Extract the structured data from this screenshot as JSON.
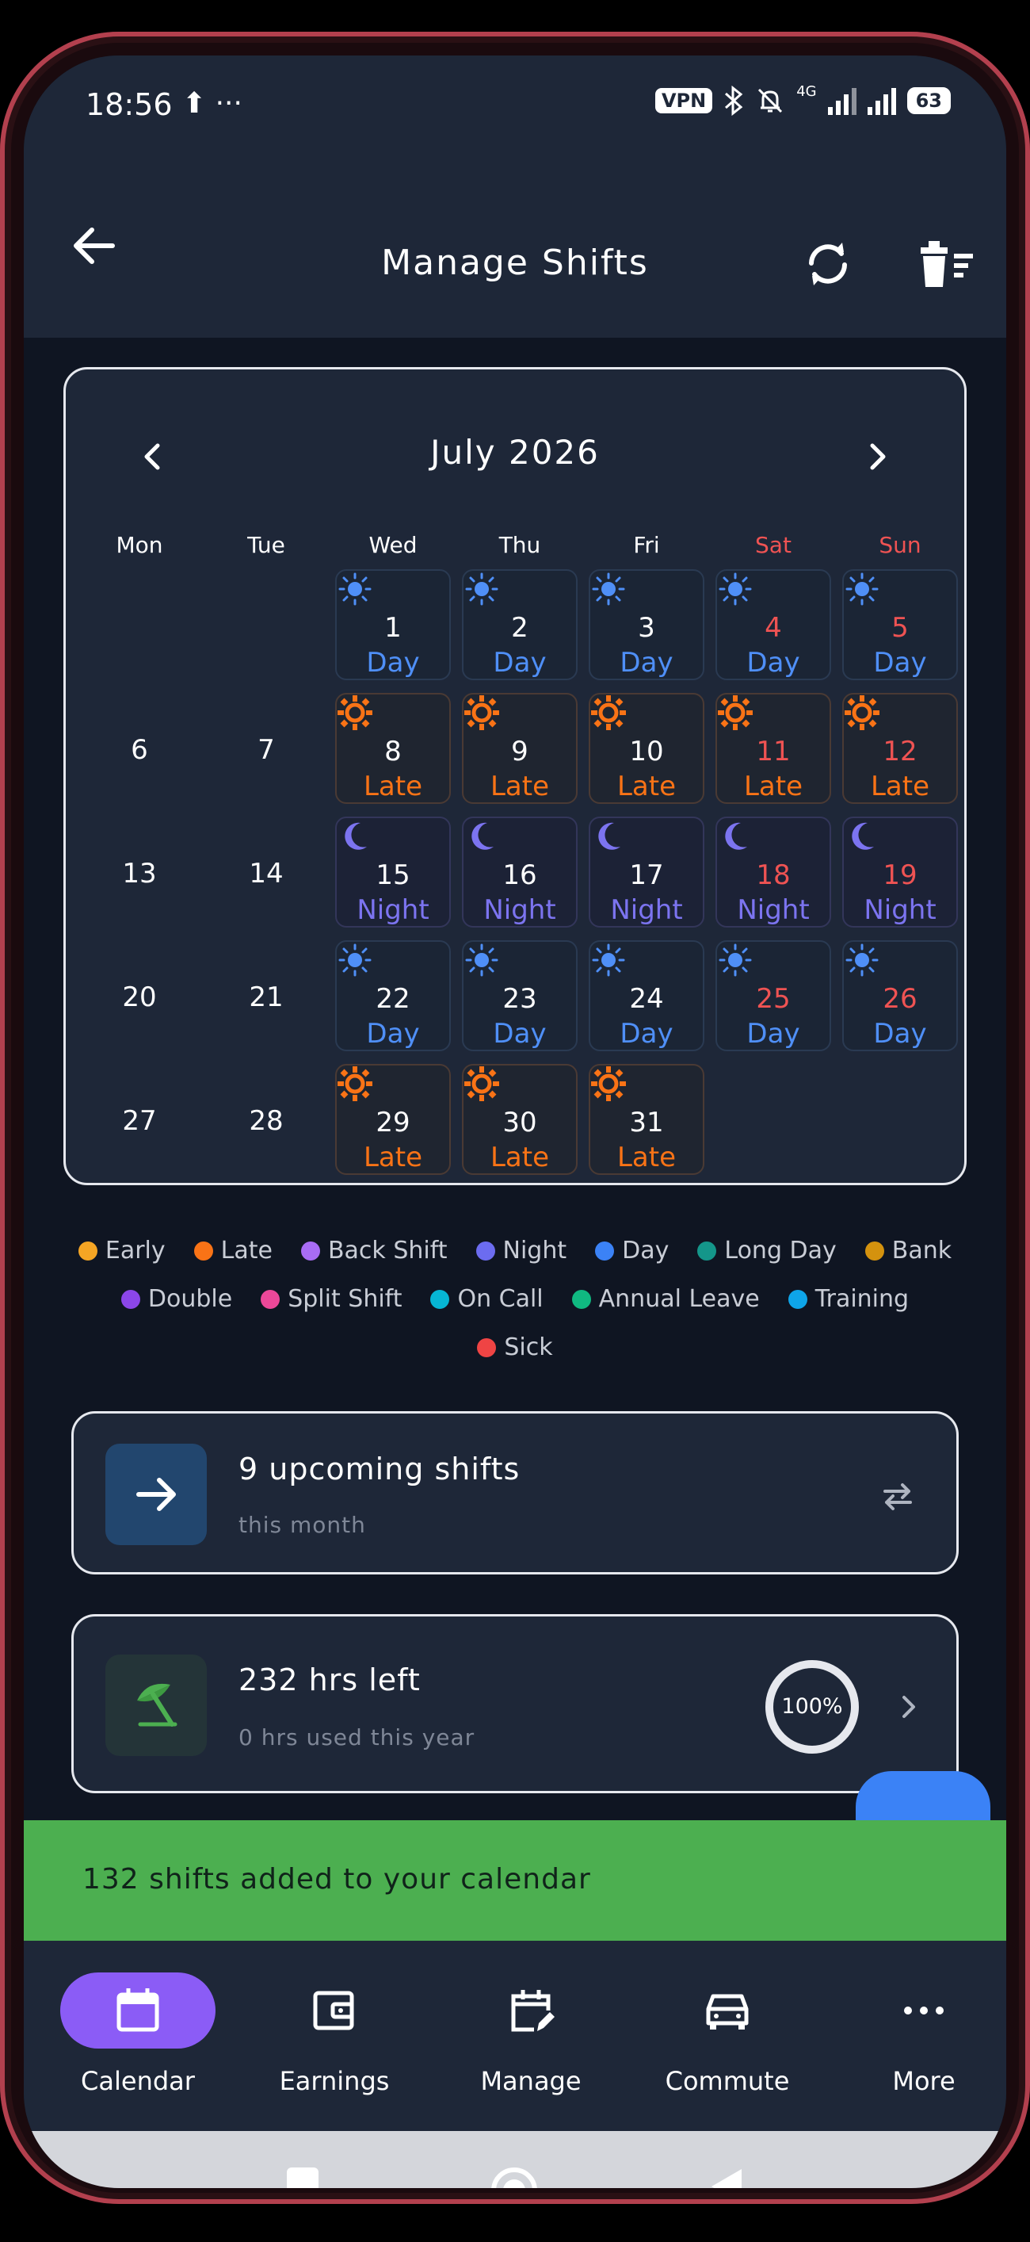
{
  "status": {
    "time": "18:56",
    "left_icons": "⬆ ···",
    "vpn": "VPN",
    "network": "4G",
    "battery": "63"
  },
  "app_bar": {
    "title": "Manage Shifts"
  },
  "calendar": {
    "month_label": "July 2026",
    "weekdays": [
      "Mon",
      "Tue",
      "Wed",
      "Thu",
      "Fri",
      "Sat",
      "Sun"
    ],
    "days": [
      {
        "day": "1",
        "shift": "Day"
      },
      {
        "day": "2",
        "shift": "Day"
      },
      {
        "day": "3",
        "shift": "Day"
      },
      {
        "day": "4",
        "shift": "Day"
      },
      {
        "day": "5",
        "shift": "Day"
      },
      {
        "day": "6",
        "shift": ""
      },
      {
        "day": "7",
        "shift": ""
      },
      {
        "day": "8",
        "shift": "Late"
      },
      {
        "day": "9",
        "shift": "Late"
      },
      {
        "day": "10",
        "shift": "Late"
      },
      {
        "day": "11",
        "shift": "Late"
      },
      {
        "day": "12",
        "shift": "Late"
      },
      {
        "day": "13",
        "shift": ""
      },
      {
        "day": "14",
        "shift": ""
      },
      {
        "day": "15",
        "shift": "Night"
      },
      {
        "day": "16",
        "shift": "Night"
      },
      {
        "day": "17",
        "shift": "Night"
      },
      {
        "day": "18",
        "shift": "Night"
      },
      {
        "day": "19",
        "shift": "Night"
      },
      {
        "day": "20",
        "shift": ""
      },
      {
        "day": "21",
        "shift": ""
      },
      {
        "day": "22",
        "shift": "Day"
      },
      {
        "day": "23",
        "shift": "Day"
      },
      {
        "day": "24",
        "shift": "Day"
      },
      {
        "day": "25",
        "shift": "Day"
      },
      {
        "day": "26",
        "shift": "Day"
      },
      {
        "day": "27",
        "shift": ""
      },
      {
        "day": "28",
        "shift": ""
      },
      {
        "day": "29",
        "shift": "Late"
      },
      {
        "day": "30",
        "shift": "Late"
      },
      {
        "day": "31",
        "shift": "Late"
      }
    ]
  },
  "legend": [
    {
      "label": "Early",
      "color": "#f5a524"
    },
    {
      "label": "Late",
      "color": "#f97316"
    },
    {
      "label": "Back Shift",
      "color": "#a86cf5"
    },
    {
      "label": "Night",
      "color": "#6c6cf0"
    },
    {
      "label": "Day",
      "color": "#3b82f6"
    },
    {
      "label": "Long Day",
      "color": "#14968a"
    },
    {
      "label": "Bank",
      "color": "#d4920e"
    },
    {
      "label": "Double",
      "color": "#8b46e8"
    },
    {
      "label": "Split Shift",
      "color": "#ec4899"
    },
    {
      "label": "On Call",
      "color": "#06b6d4"
    },
    {
      "label": "Annual Leave",
      "color": "#10b981"
    },
    {
      "label": "Training",
      "color": "#0ea5e9"
    },
    {
      "label": "Sick",
      "color": "#ef4444"
    }
  ],
  "upcoming": {
    "title": "9 upcoming shifts",
    "subtitle": "this month"
  },
  "hours": {
    "title": "232 hrs left",
    "subtitle": "0 hrs used this year",
    "progress_label": "100%",
    "progress": 1.0
  },
  "snackbar": {
    "text": "132 shifts added to your calendar"
  },
  "bottom_nav": [
    {
      "label": "Calendar",
      "icon": "calendar-icon",
      "active": true
    },
    {
      "label": "Earnings",
      "icon": "wallet-icon",
      "active": false
    },
    {
      "label": "Manage",
      "icon": "calendar-edit-icon",
      "active": false
    },
    {
      "label": "Commute",
      "icon": "car-icon",
      "active": false
    },
    {
      "label": "More",
      "icon": "more-dots-icon",
      "active": false
    }
  ],
  "colors": {
    "day": "#4f8ff7",
    "late": "#f97316",
    "night": "#7c74f0",
    "weekend": "#ef5353",
    "accent": "#8b5cf6",
    "snackbar": "#4caf50"
  }
}
